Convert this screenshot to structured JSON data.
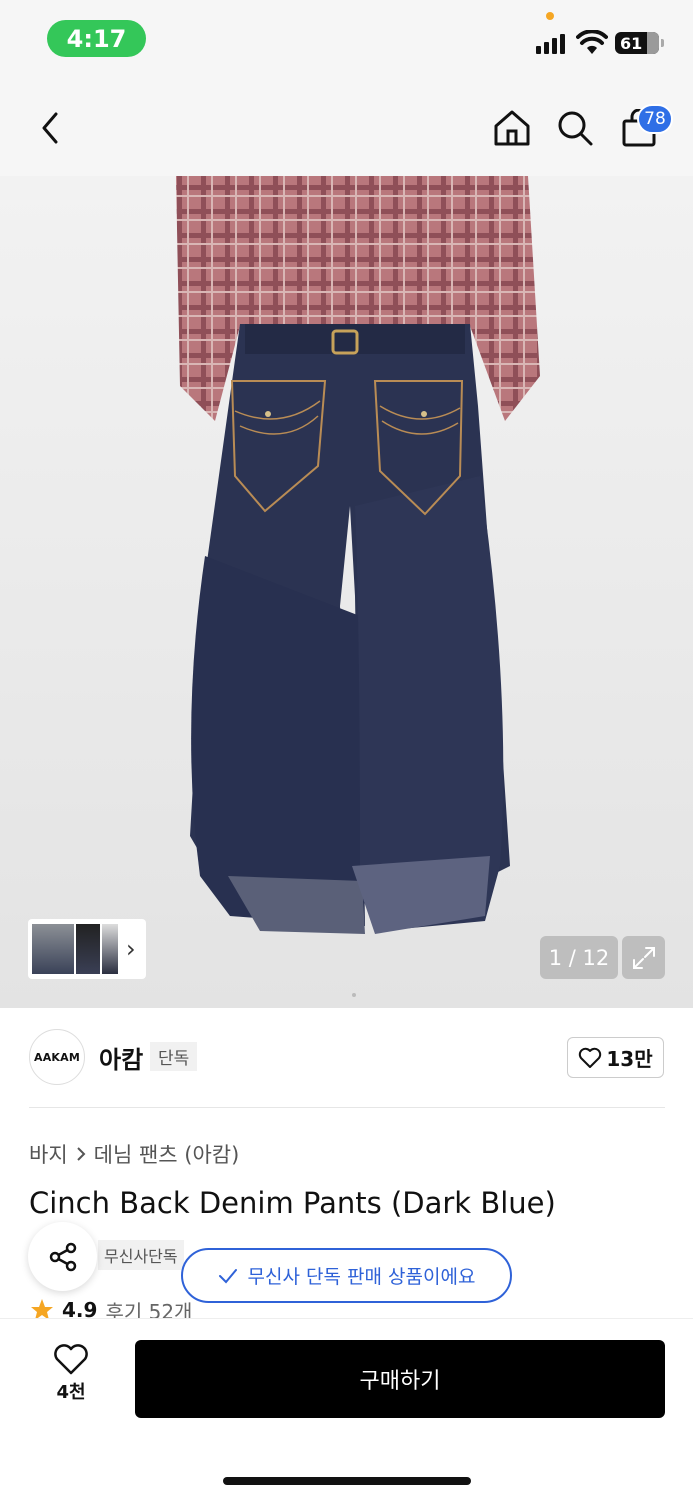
{
  "status_bar": {
    "time": "4:17",
    "battery_level": "61"
  },
  "nav": {
    "cart_badge": "78",
    "icons": [
      "back-icon",
      "home-icon",
      "search-icon",
      "cart-icon"
    ]
  },
  "gallery": {
    "counter": "1 / 12",
    "thumb_arrow": "›"
  },
  "brand": {
    "logo_text": "AAKAM",
    "name": "아캄",
    "tag": "단독",
    "likes": "13만"
  },
  "product": {
    "breadcrumb": [
      "바지",
      "데님 팬츠 (아캄)"
    ],
    "title": "Cinch Back Denim Pants (Dark Blue)",
    "tag": "무신사단독",
    "exclusive_notice": "무신사 단독 판매 상품이에요",
    "rating": "4.9",
    "reviews": "후기 52개"
  },
  "bottom": {
    "wish_count": "4천",
    "buy_label": "구매하기"
  },
  "colors": {
    "accent_blue": "#2f62d8",
    "status_green": "#34c759",
    "star": "#f5a623"
  }
}
